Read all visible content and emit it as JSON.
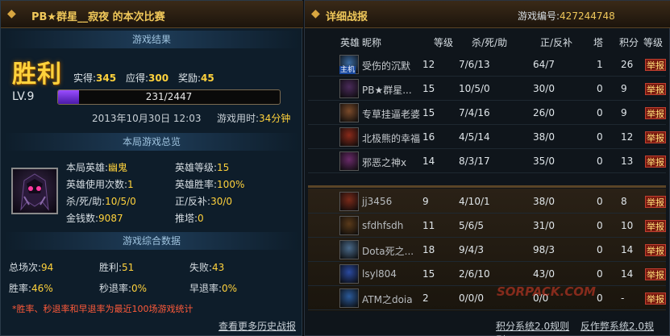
{
  "left": {
    "title": "PB★群星__寂夜 的本次比赛",
    "result_section": "游戏结果",
    "result": "胜利",
    "earned_label": "实得:",
    "earned": "345",
    "should_label": "应得:",
    "should": "300",
    "reward_label": "奖励:",
    "reward": "45",
    "level": "LV.9",
    "xp_text": "231/2447",
    "xp_fraction": 0.094,
    "datetime": "2013年10月30日 12:03",
    "duration_label": "游戏用时:",
    "duration": "34分钟",
    "overview_section": "本局游戏总览",
    "hero": {
      "name_label": "本局英雄:",
      "name": "幽鬼",
      "level_label": "英雄等级:",
      "level": "15",
      "uses_label": "英雄使用次数:",
      "uses": "1",
      "winrate_label": "英雄胜率:",
      "winrate": "100%",
      "kda_label": "杀/死/助:",
      "kda": "10/5/0",
      "cs_label": "正/反补:",
      "cs": "30/0",
      "gold_label": "金钱数:",
      "gold": "9087",
      "towers_label": "推塔:",
      "towers": "0"
    },
    "stats_section": "游戏综合数据",
    "stats": {
      "total_label": "总场次:",
      "total": "94",
      "wins_label": "胜利:",
      "wins": "51",
      "losses_label": "失败:",
      "losses": "43",
      "winrate_label": "胜率:",
      "winrate": "46%",
      "quit_label": "秒退率:",
      "quit": "0%",
      "early_label": "早退率:",
      "early": "0%"
    },
    "note": "*胜率、秒退率和早退率为最近100场游戏统计",
    "more_link": "查看更多历史战报"
  },
  "right": {
    "title": "详细战报",
    "game_id_label": "游戏编号:",
    "game_id": "427244748",
    "headers": {
      "hero": "英雄",
      "nick": "昵称",
      "level": "等级",
      "kda": "杀/死/助",
      "cs": "正/反补",
      "tower": "塔",
      "score": "积分",
      "rank": "等级"
    },
    "report_label": "举报",
    "host_tag": "主机",
    "team1": [
      {
        "name": "受伤的沉默",
        "level": "12",
        "kda": "7/6/13",
        "cs": "64/7",
        "tower": "1",
        "score": "26",
        "avatar_color": "#3a6aa0"
      },
      {
        "name": "PB★群星...",
        "level": "15",
        "kda": "10/5/0",
        "cs": "30/0",
        "tower": "0",
        "score": "9",
        "avatar_color": "#4a2a5a"
      },
      {
        "name": "专草挂逼老婆",
        "level": "15",
        "kda": "7/4/16",
        "cs": "26/0",
        "tower": "0",
        "score": "9",
        "avatar_color": "#7a4a2a"
      },
      {
        "name": "北极熊的幸福",
        "level": "16",
        "kda": "4/5/14",
        "cs": "38/0",
        "tower": "0",
        "score": "12",
        "avatar_color": "#8a2a1a"
      },
      {
        "name": "邪恶之神x",
        "level": "14",
        "kda": "8/3/17",
        "cs": "35/0",
        "tower": "0",
        "score": "13",
        "avatar_color": "#6a2a6a"
      }
    ],
    "team2": [
      {
        "name": "jj3456",
        "level": "9",
        "kda": "4/10/1",
        "cs": "38/0",
        "tower": "0",
        "score": "8",
        "avatar_color": "#7a2a1a"
      },
      {
        "name": "sfdhfsdh",
        "level": "11",
        "kda": "5/6/5",
        "cs": "31/0",
        "tower": "0",
        "score": "10",
        "avatar_color": "#5a3a1a"
      },
      {
        "name": "Dota死之...",
        "level": "18",
        "kda": "9/4/3",
        "cs": "98/3",
        "tower": "0",
        "score": "14",
        "avatar_color": "#4a6a8a"
      },
      {
        "name": "lsyl804",
        "level": "15",
        "kda": "2/6/10",
        "cs": "43/0",
        "tower": "0",
        "score": "14",
        "avatar_color": "#2a4aa0"
      },
      {
        "name": "ATM之doia",
        "level": "2",
        "kda": "0/0/0",
        "cs": "0/0",
        "tower": "0",
        "score": "-",
        "avatar_color": "#2a5a9a"
      }
    ],
    "footer_links": [
      "积分系统2.0规则",
      "反作弊系统2.0规则"
    ],
    "watermark": "SORPACK.COM"
  }
}
